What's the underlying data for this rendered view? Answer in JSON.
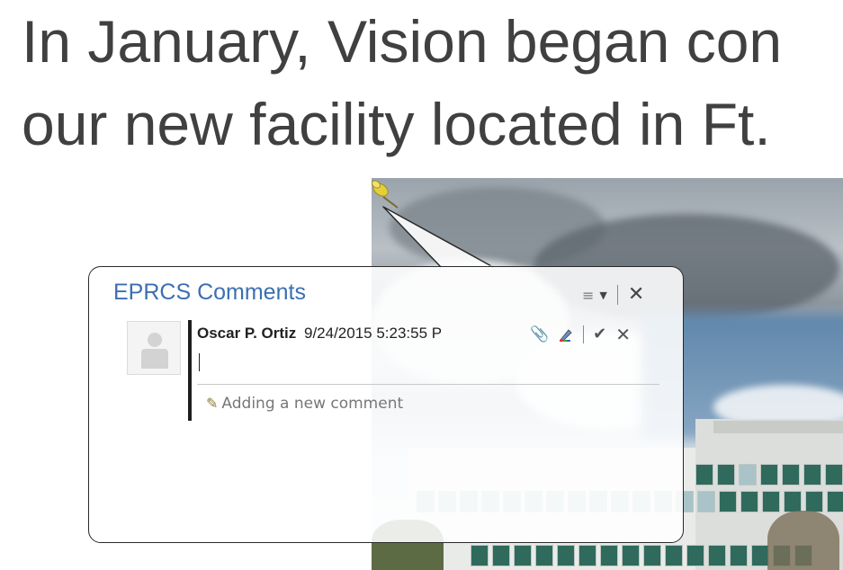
{
  "slide": {
    "line1": "In January, Vision began con",
    "line2": "our new facility located in Ft."
  },
  "comments": {
    "panel_title": "EPRCS Comments",
    "comment": {
      "author": "Oscar P. Ortiz",
      "timestamp": "9/24/2015 5:23:55 P",
      "status": "Adding a new comment",
      "editor_value": ""
    }
  }
}
